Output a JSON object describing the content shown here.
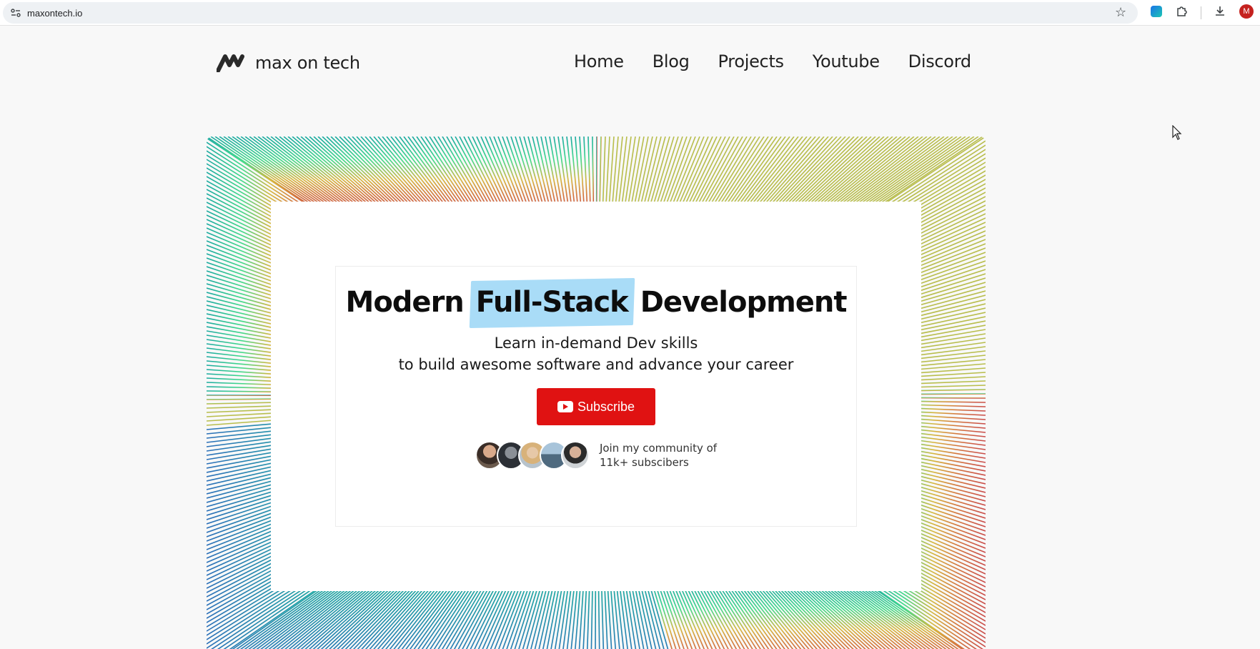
{
  "browser": {
    "url": "maxontech.io",
    "profile_initial": "M",
    "icons": [
      "site-info-icon",
      "bookmark-star-icon",
      "extension-icon",
      "extensions-puzzle-icon",
      "download-icon"
    ]
  },
  "site": {
    "logo_text": "max on tech",
    "nav": [
      {
        "label": "Home"
      },
      {
        "label": "Blog"
      },
      {
        "label": "Projects"
      },
      {
        "label": "Youtube"
      },
      {
        "label": "Discord"
      }
    ]
  },
  "hero": {
    "headline_before": "Modern",
    "headline_highlight": "Full-Stack",
    "headline_after": "Development",
    "subline_1": "Learn in-demand Dev skills",
    "subline_2": "to build awesome software and advance your career",
    "subscribe_label": "Subscribe",
    "community_line_1": "Join my community of",
    "community_line_2": "11k+ subscibers",
    "highlight_color": "#a9dcf7",
    "button_color": "#e01212"
  },
  "colors": {
    "frame_gradient": [
      "#1aa9a0",
      "#3fd98a",
      "#d6b63c",
      "#d4763c",
      "#c94a4a",
      "#2a6fb8"
    ]
  }
}
